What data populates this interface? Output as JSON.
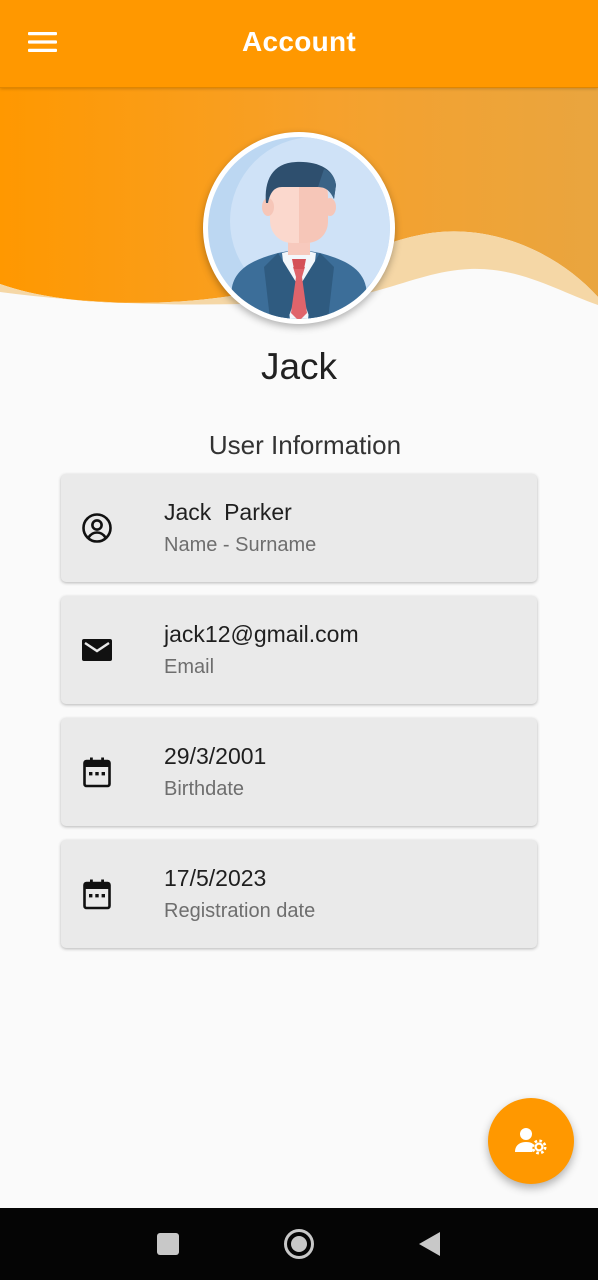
{
  "appbar": {
    "title": "Account",
    "menu_icon": "hamburger-menu-icon",
    "color": "#ff9800"
  },
  "profile": {
    "name": "Jack",
    "avatar_icon": "businessman-avatar-icon"
  },
  "user_info": {
    "title": "User Information",
    "items": [
      {
        "value": "Jack  Parker",
        "label": "Name - Surname",
        "icon": "account-circle-icon"
      },
      {
        "value": "jack12@gmail.com",
        "label": "Email",
        "icon": "email-icon"
      },
      {
        "value": "29/3/2001",
        "label": "Birthdate",
        "icon": "calendar-icon"
      },
      {
        "value": "17/5/2023",
        "label": "Registration date",
        "icon": "calendar-icon"
      }
    ]
  },
  "fab": {
    "icon": "user-settings-icon",
    "color": "#ff9800"
  },
  "system_nav": {
    "buttons": [
      "recent-apps-icon",
      "home-icon",
      "back-icon"
    ]
  }
}
